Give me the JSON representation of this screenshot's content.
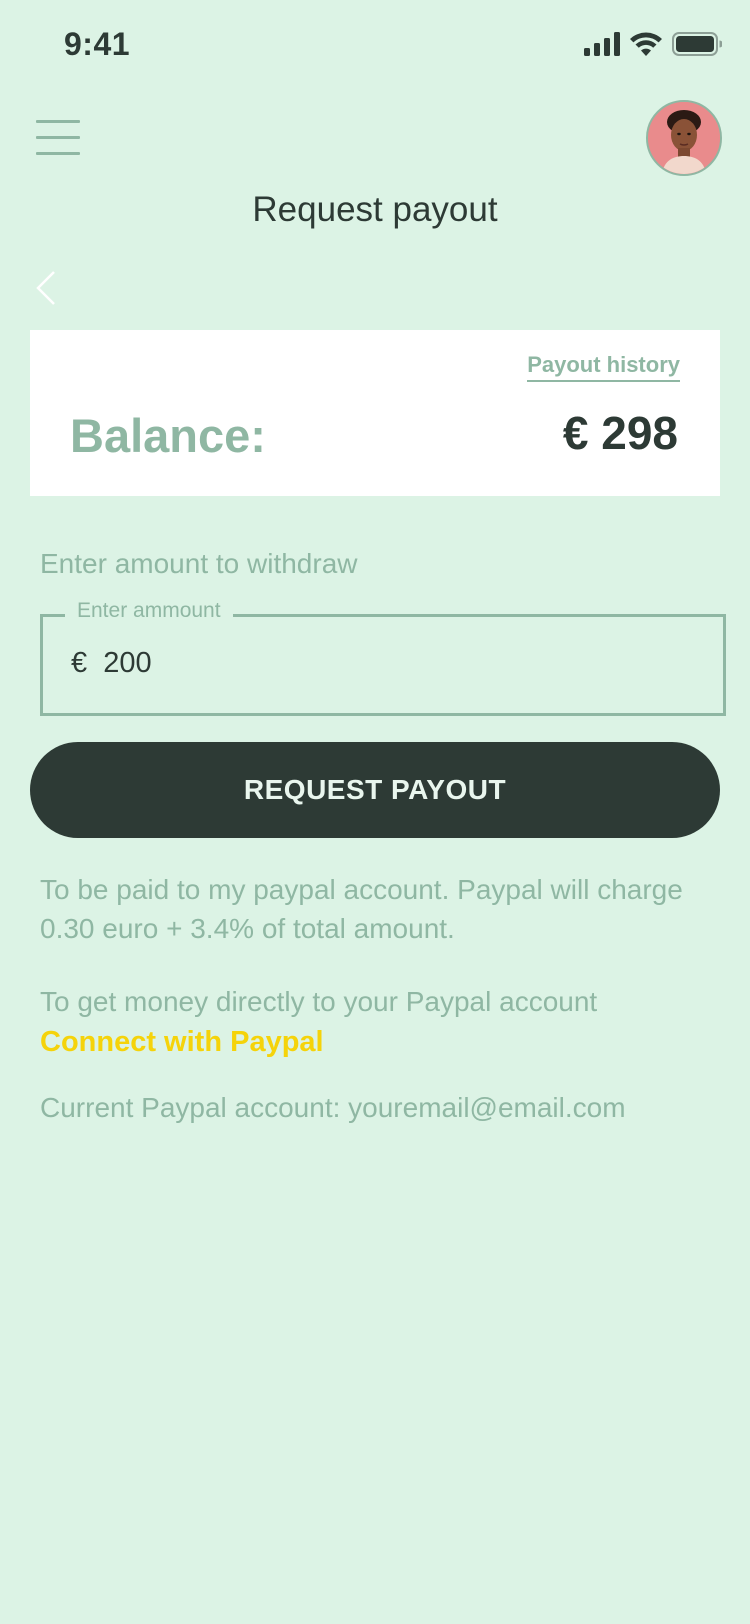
{
  "status_bar": {
    "time": "9:41"
  },
  "header": {
    "title": "Request payout"
  },
  "balance_card": {
    "history_link": "Payout history",
    "label": "Balance:",
    "value": "€ 298"
  },
  "withdraw": {
    "label": "Enter amount to withdraw",
    "field_label": "Enter ammount",
    "field_value": "€  200"
  },
  "actions": {
    "request_label": "REQUEST PAYOUT"
  },
  "info": {
    "fee_note": "To be paid to my paypal account. Paypal will charge  0.30 euro + 3.4% of total amount.",
    "connect_prompt": "To get money directly to your Paypal account",
    "connect_link": "Connect with Paypal",
    "current_account": "Current Paypal account: youremail@email.com"
  },
  "colors": {
    "background": "#dcf3e5",
    "accent_muted": "#8fb7a3",
    "dark": "#2d3a35",
    "link_yellow": "#f5d30a"
  },
  "icons": {
    "menu": "hamburger-menu-icon",
    "back": "chevron-left-icon",
    "signal": "cellular-signal-icon",
    "wifi": "wifi-icon",
    "battery": "battery-icon"
  }
}
